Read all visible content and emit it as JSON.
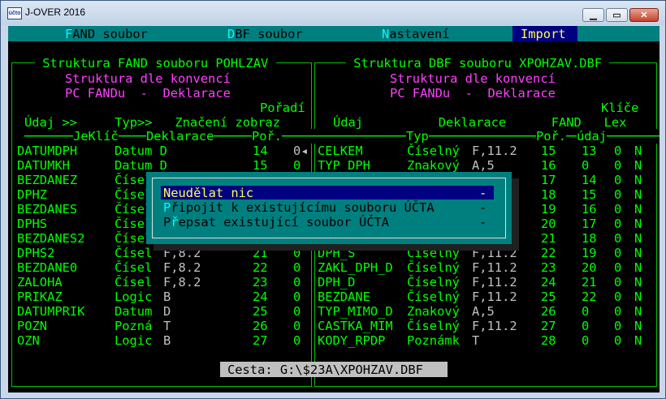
{
  "window": {
    "title": "J-OVER 2016",
    "icon_text": "účto",
    "buttons": [
      "minimize-icon",
      "maximize-icon",
      "close-icon"
    ]
  },
  "menu": {
    "items": [
      {
        "hot": "F",
        "rest": "AND soubor"
      },
      {
        "hot": "D",
        "rest": "BF soubor"
      },
      {
        "hot": "N",
        "rest": "astavení"
      },
      {
        "label": "Import"
      }
    ]
  },
  "left": {
    "title": " Struktura FAND souboru POHLZAV ",
    "sub1": "Struktura dle konvencí",
    "sub2": "PC FANDu  -  Deklarace",
    "h1": "Pořadí",
    "h2": "Údaj >>     Typ>>   Značení zobraz",
    "h3": "JeKlíč",
    "h4": "Deklarace",
    "h5": "Poř.",
    "rows": [
      [
        "DATUMDPH",
        "Datum D",
        "",
        "14",
        "0◂"
      ],
      [
        "DATUMKH",
        "Datum D",
        "",
        "15",
        "0"
      ],
      [
        "BEZDANEZ",
        "Čísel",
        "",
        "",
        ""
      ],
      [
        "DPHZ",
        "Čísel",
        "",
        "",
        ""
      ],
      [
        "BEZDANES",
        "Čísel",
        "",
        "",
        ""
      ],
      [
        "DPHS",
        "Čísel",
        "",
        "",
        ""
      ],
      [
        "BEZDANES2",
        "Čísel",
        "",
        "",
        ""
      ],
      [
        "DPHS2",
        "Čísel",
        "F,8.2",
        "21",
        "0"
      ],
      [
        "BEZDANE0",
        "Čísel",
        "F,8.2",
        "22",
        "0"
      ],
      [
        "ZALOHA",
        "Čísel",
        "F,8.2",
        "23",
        "0"
      ],
      [
        "PRIKAZ",
        "Logic",
        "B",
        "24",
        "0"
      ],
      [
        "DATUMPRIK",
        "Datum",
        "D",
        "25",
        "0"
      ],
      [
        "POZN",
        "Pozná",
        "T",
        "26",
        "0"
      ],
      [
        "OZN",
        "Logic",
        "B",
        "27",
        "0"
      ]
    ]
  },
  "right": {
    "title": " Struktura DBF souboru XPOHZAV.DBF ",
    "sub1": "Struktura dle konvencí",
    "sub2": "PC FANDu  -  Deklarace",
    "h1": "Klíče",
    "h2": "Údaj          Deklarace      FAND   Lex",
    "h3": "Typ",
    "h4": "Poř.",
    "h5": "údaj",
    "rows": [
      [
        "CELKEM",
        "Číselný",
        "F,11.2",
        "15",
        "13",
        "0",
        "N"
      ],
      [
        "TYP_DPH",
        "Znakový",
        "A,5",
        "16",
        "0",
        "0",
        "N"
      ],
      [
        "",
        "",
        "",
        "17",
        "14",
        "0",
        "N"
      ],
      [
        "",
        "",
        "",
        "18",
        "15",
        "0",
        "N"
      ],
      [
        "",
        "",
        "2",
        "19",
        "16",
        "0",
        "N"
      ],
      [
        "",
        "",
        "2",
        "20",
        "17",
        "0",
        "N"
      ],
      [
        "",
        "",
        "2",
        "21",
        "18",
        "0",
        "N"
      ],
      [
        "DPH_S",
        "Číselný",
        "F,11.2",
        "22",
        "19",
        "0",
        "N"
      ],
      [
        "ZAKL_DPH_D",
        "Číselný",
        "F,11.2",
        "23",
        "20",
        "0",
        "N"
      ],
      [
        "DPH_D",
        "Číselný",
        "F,11.2",
        "24",
        "21",
        "0",
        "N"
      ],
      [
        "BEZDANE",
        "Číselný",
        "F,11.2",
        "25",
        "22",
        "0",
        "N"
      ],
      [
        "TYP_MIMO_D",
        "Znakový",
        "A,5",
        "26",
        "0",
        "0",
        "N"
      ],
      [
        "CASTKA_MIM",
        "Číselný",
        "F,11.2",
        "27",
        "0",
        "0",
        "N"
      ],
      [
        "KODY_RPDP",
        "Poznámk",
        "T",
        "28",
        "0",
        "0",
        "N"
      ]
    ]
  },
  "dialog": {
    "options": [
      {
        "hot": "",
        "label": "Neudělat nic",
        "dash": "-"
      },
      {
        "hot": "P",
        "label": "řipojit k existujícímu souboru ÚČTA",
        "dash": "-"
      },
      {
        "pre": "P",
        "hot": "ř",
        "label": "epsat existující soubor ÚČTA",
        "dash": "-"
      }
    ]
  },
  "status": {
    "text": "Cesta: G:\\$23A\\XPOHZAV.DBF"
  },
  "colors": {
    "screen": "#000000",
    "menu": "#007f7f",
    "green": "#00ff00",
    "magenta": "#ff40ff",
    "cyan": "#00ffff",
    "white": "#c0c0c0",
    "yellow": "#ffff55",
    "navy": "#000080"
  }
}
